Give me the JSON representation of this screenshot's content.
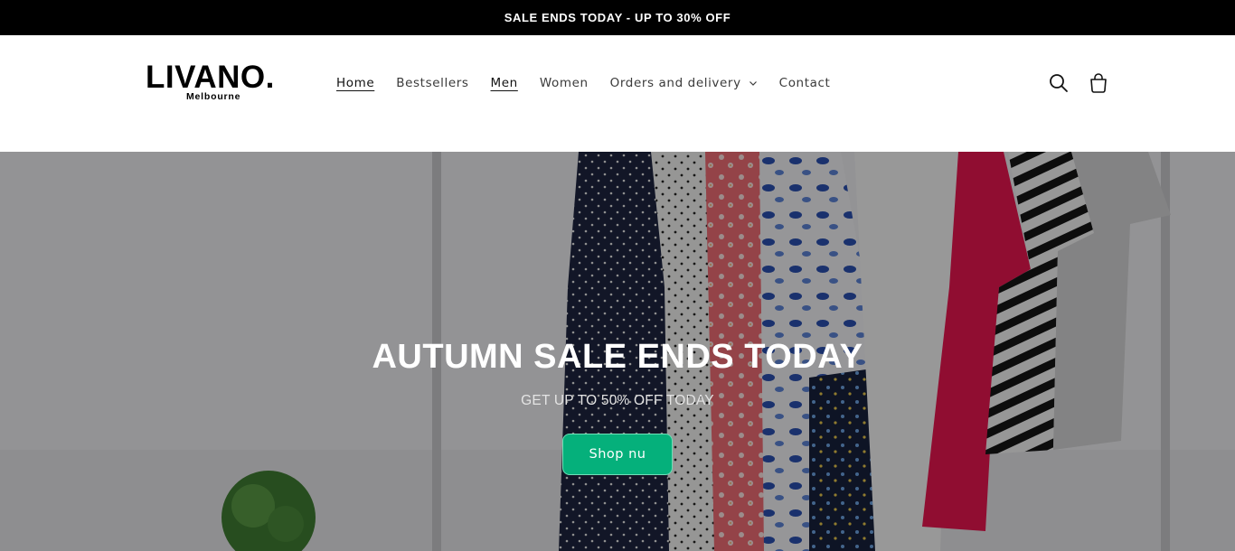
{
  "announcement": {
    "text": "SALE ENDS TODAY - UP TO 30% OFF"
  },
  "header": {
    "logo": {
      "main": "LIVANO.",
      "sub": "Melbourne"
    },
    "nav": [
      {
        "label": "Home",
        "active": true
      },
      {
        "label": "Bestsellers",
        "active": false
      },
      {
        "label": "Men",
        "active": true
      },
      {
        "label": "Women",
        "active": false
      },
      {
        "label": "Orders and delivery",
        "active": false,
        "dropdown": true
      },
      {
        "label": "Contact",
        "active": false
      }
    ],
    "icons": [
      "search-icon",
      "cart-icon"
    ]
  },
  "hero": {
    "title": "AUTUMN SALE ENDS TODAY",
    "subtitle": "GET UP TO 50% OFF TODAY",
    "button_label": "Shop nu",
    "button_color": "#05b07b"
  }
}
